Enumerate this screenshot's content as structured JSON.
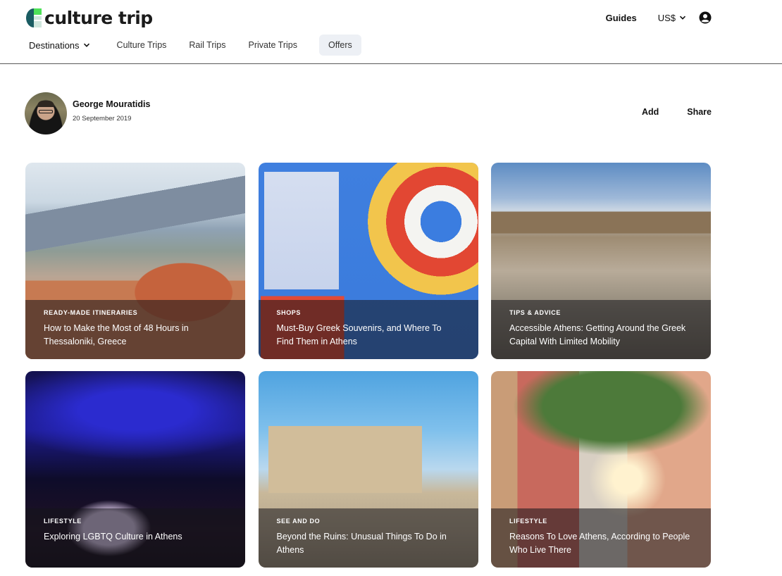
{
  "brand": {
    "name": "culture trip",
    "colors": {
      "green": "#4de158",
      "teal": "#1a5c62",
      "mint": "#cfe6dd"
    }
  },
  "header": {
    "destinations_label": "Destinations",
    "nav": [
      "Culture Trips",
      "Rail Trips",
      "Private Trips",
      "Offers"
    ],
    "guides_label": "Guides",
    "currency_label": "US$",
    "account_icon": "account-circle-icon"
  },
  "author": {
    "name": "George Mouratidis",
    "date": "20 September 2019"
  },
  "actions": {
    "add_label": "Add",
    "share_label": "Share"
  },
  "cards": [
    {
      "category": "READY-MADE ITINERARIES",
      "title": "How to Make the Most of 48 Hours in Thessaloniki, Greece"
    },
    {
      "category": "SHOPS",
      "title": "Must-Buy Greek Souvenirs, and Where To Find Them in Athens"
    },
    {
      "category": "TIPS & ADVICE",
      "title": "Accessible Athens: Getting Around the Greek Capital With Limited Mobility"
    },
    {
      "category": "LIFESTYLE",
      "title": "Exploring LGBTQ Culture in Athens"
    },
    {
      "category": "SEE AND DO",
      "title": "Beyond the Ruins: Unusual Things To Do in Athens"
    },
    {
      "category": "LIFESTYLE",
      "title": "Reasons To Love Athens, According to People Who Live There"
    }
  ]
}
